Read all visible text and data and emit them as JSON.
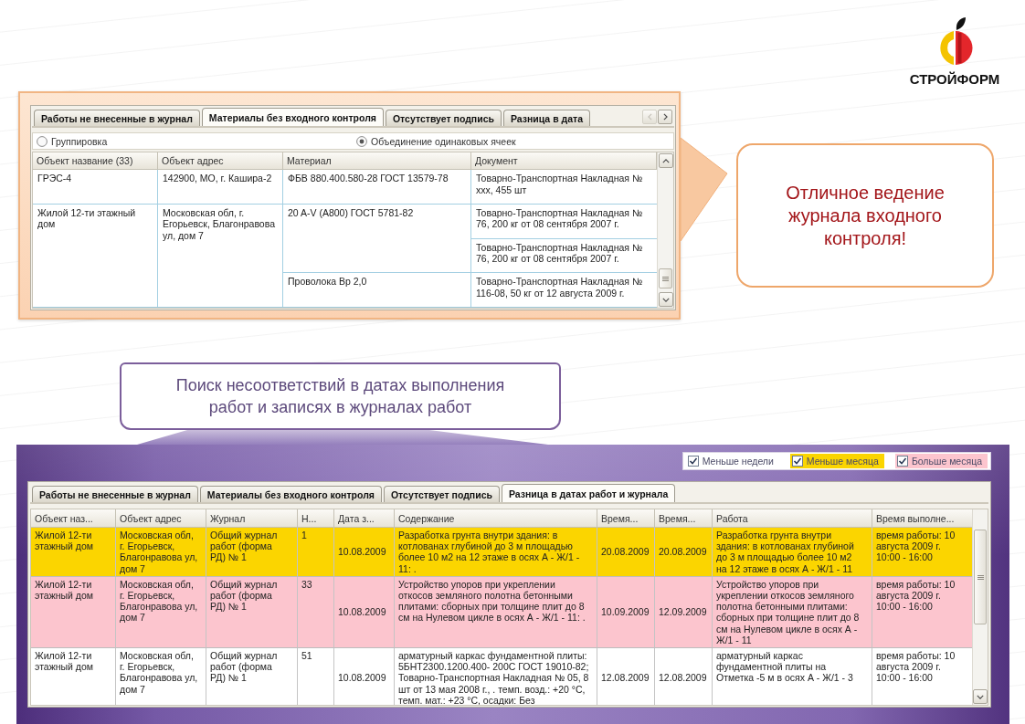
{
  "logo": {
    "name": "СТРОЙФОРМ"
  },
  "top_panel": {
    "tabs": [
      {
        "label": "Работы не внесенные в журнал",
        "selected": false
      },
      {
        "label": "Материалы без входного контроля",
        "selected": true
      },
      {
        "label": "Отсутствует подпись",
        "selected": false
      },
      {
        "label": "Разница в дата",
        "selected": false
      }
    ],
    "tab_scroll_buttons": [
      {
        "kind": "previous",
        "disabled": true
      },
      {
        "kind": "next",
        "disabled": false
      }
    ],
    "view_options": [
      {
        "label": "Группировка",
        "selected": false
      },
      {
        "label": "Объединение одинаковых ячеек",
        "selected": true
      }
    ],
    "table": {
      "columns": [
        "Объект название (33)",
        "Объект адрес",
        "Материал",
        "Документ"
      ],
      "groups": [
        {
          "object": "ГРЭС-4",
          "address": "142900, МО, г. Кашира-2",
          "materials": [
            {
              "material": "ФБВ 880.400.580-28 ГОСТ 13579-78",
              "documents": [
                "Товарно-Транспортная Накладная № xxx, 455 шт"
              ]
            }
          ]
        },
        {
          "object": "Жилой 12-ти этажный дом",
          "address": "Московская обл, г. Егорьевск, Благонравова ул, дом 7",
          "materials": [
            {
              "material": "20 A-V (A800) ГОСТ 5781-82",
              "documents": [
                "Товарно-Транспортная Накладная № 76, 200 кг от 08 сентября 2007 г.",
                "Товарно-Транспортная Накладная № 76, 200 кг от 08 сентября 2007 г."
              ]
            },
            {
              "material": "Проволока Вр 2,0",
              "documents": [
                "Товарно-Транспортная Накладная № 116-08, 50 кг от 12 августа 2009 г."
              ]
            }
          ]
        }
      ]
    }
  },
  "top_callout": {
    "text": "Отличное ведение журнала входного контроля!"
  },
  "bottom_callout": {
    "text": "Поиск несоответствий в датах выполнения работ и записях в журналах работ"
  },
  "bottom_panel": {
    "legend": [
      {
        "label": "Меньше недели",
        "checked": true,
        "color": "#ffffff"
      },
      {
        "label": "Меньше месяца",
        "checked": true,
        "color": "#fbd500"
      },
      {
        "label": "Больше месяца",
        "checked": true,
        "color": "#fcc5ce"
      }
    ],
    "tabs": [
      {
        "label": "Работы не внесенные в журнал",
        "selected": false
      },
      {
        "label": "Материалы без входного контроля",
        "selected": false
      },
      {
        "label": "Отсутствует подпись",
        "selected": false
      },
      {
        "label": "Разница в датах работ и журнала",
        "selected": true
      }
    ],
    "table": {
      "columns": [
        {
          "label": "Объект наз...",
          "kind": "text"
        },
        {
          "label": "Объект адрес",
          "kind": "text"
        },
        {
          "label": "Журнал",
          "kind": "text"
        },
        {
          "label": "Н...",
          "kind": "text"
        },
        {
          "label": "Дата з...",
          "kind": "date"
        },
        {
          "label": "Содержание",
          "kind": "text"
        },
        {
          "label": "Время...",
          "kind": "date"
        },
        {
          "label": "Время...",
          "kind": "date"
        },
        {
          "label": "Работа",
          "kind": "text"
        },
        {
          "label": "Время выполне...",
          "kind": "text"
        }
      ],
      "rows": [
        {
          "color": "#fbd500",
          "cells": [
            "Жилой 12-ти этажный дом",
            "Московская обл, г. Егорьевск, Благонравова ул, дом 7",
            "Общий журнал работ (форма РД) № 1",
            "1",
            "10.08.2009",
            "Разработка грунта внутри здания: в котлованах глубиной до 3 м площадью более 10 м2 на 12 этаже в осях А - Ж/1 - 11:   .",
            "20.08.2009",
            "20.08.2009",
            "Разработка грунта внутри здания: в котлованах глубиной до 3 м площадью более 10 м2 на 12 этаже в осях А - Ж/1 - 11",
            "время работы: 10 августа 2009 г. 10:00 - 16:00"
          ]
        },
        {
          "color": "#fcc5ce",
          "cells": [
            "Жилой 12-ти этажный дом",
            "Московская обл, г. Егорьевск, Благонравова ул, дом 7",
            "Общий журнал работ (форма РД) № 1",
            "33",
            "10.08.2009",
            "Устройство упоров при укреплении откосов земляного полотна бетонными плитами: сборных при толщине плит до 8 см на Нулевом цикле в осях А - Ж/1 - 11: .",
            "10.09.2009",
            "12.09.2009",
            "Устройство упоров при укреплении откосов земляного полотна бетонными плитами: сборных при толщине плит до 8 см на Нулевом цикле в осях А - Ж/1 - 11",
            "время работы: 10 августа 2009 г. 10:00 - 16:00"
          ]
        },
        {
          "color": "#ffffff",
          "cells": [
            "Жилой 12-ти этажный дом",
            "Московская обл, г. Егорьевск, Благонравова ул, дом 7",
            "Общий журнал работ (форма РД) № 1",
            "51",
            "10.08.2009",
            "арматурный каркас фундаментной плиты: 5БНТ2300.1200.400- 200С ГОСТ 19010-82; Товарно-Транспортная Накладная № 05, 8 шт от 13 мая 2008 г., .   темп. возд.: +20 °С, темп. мат.: +23 °С, осадки: Без",
            "12.08.2009",
            "12.08.2009",
            "арматурный каркас фундаментной плиты на Отметка -5 м в осях А - Ж/1 - 3",
            "время работы: 10 августа 2009 г. 10:00 - 16:00"
          ]
        }
      ]
    }
  }
}
